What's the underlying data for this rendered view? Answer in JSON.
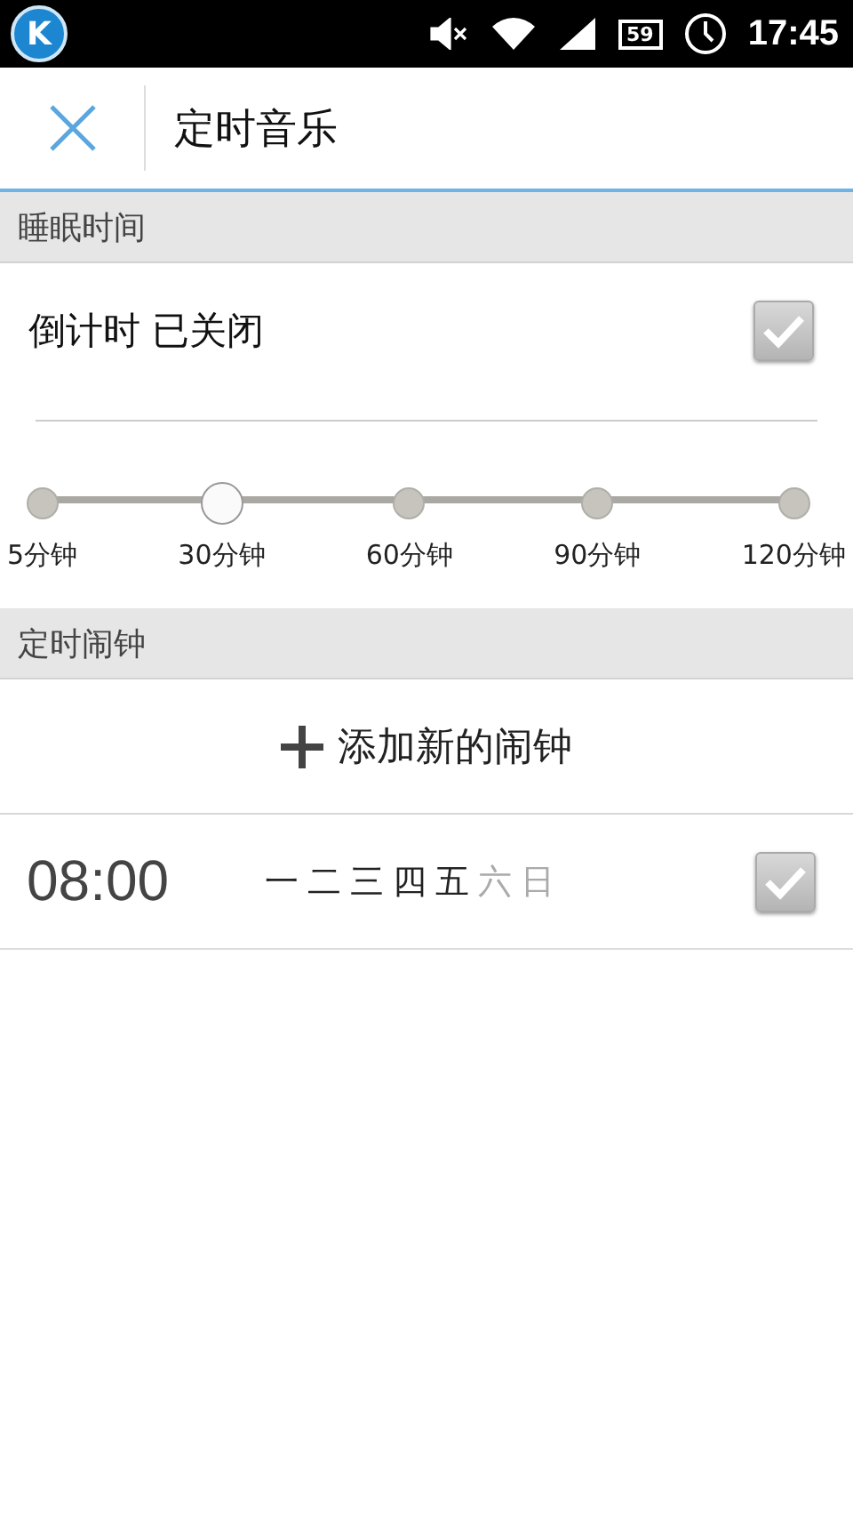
{
  "status_bar": {
    "app_badge": "K",
    "battery": "59",
    "time": "17:45"
  },
  "header": {
    "title": "定时音乐"
  },
  "sleep_section": {
    "heading": "睡眠时间",
    "countdown_label": "倒计时 已关闭",
    "checked": true,
    "stops": [
      {
        "label": "5分钟",
        "selected": false
      },
      {
        "label": "30分钟",
        "selected": true
      },
      {
        "label": "60分钟",
        "selected": false
      },
      {
        "label": "90分钟",
        "selected": false
      },
      {
        "label": "120分钟",
        "selected": false
      }
    ]
  },
  "alarm_section": {
    "heading": "定时闹钟",
    "add_button": "添加新的闹钟",
    "alarms": [
      {
        "time": "08:00",
        "checked": true,
        "days": [
          {
            "label": "一",
            "on": true
          },
          {
            "label": "二",
            "on": true
          },
          {
            "label": "三",
            "on": true
          },
          {
            "label": "四",
            "on": true
          },
          {
            "label": "五",
            "on": true
          },
          {
            "label": "六",
            "on": false
          },
          {
            "label": "日",
            "on": false
          }
        ]
      }
    ]
  }
}
